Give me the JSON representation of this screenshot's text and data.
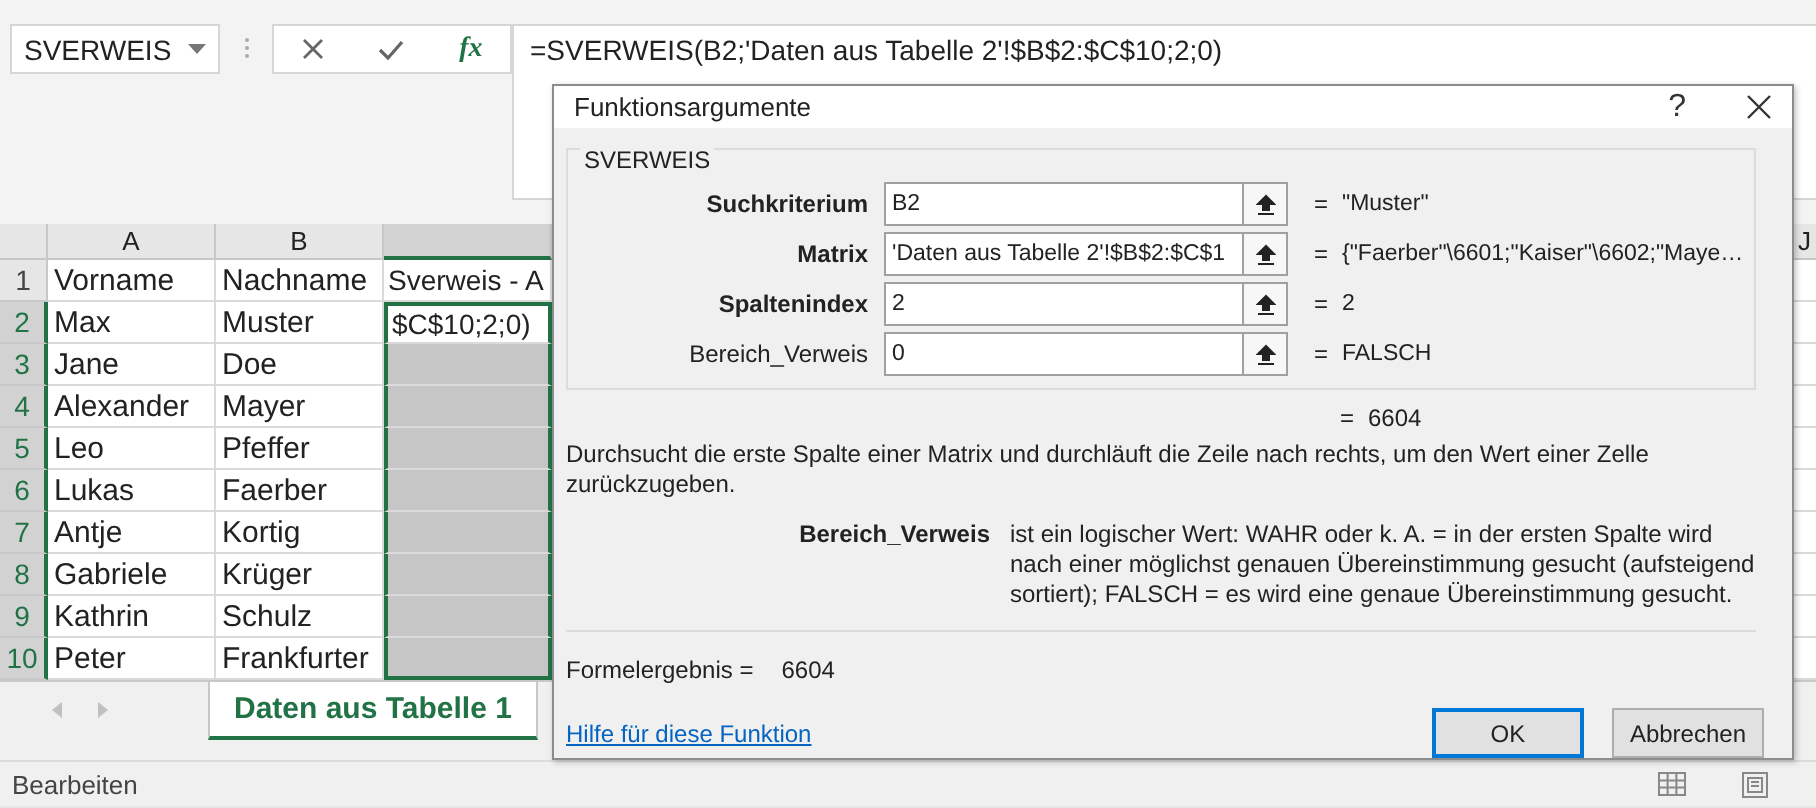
{
  "name_box": {
    "value": "SVERWEIS"
  },
  "formula_bar": {
    "fx": "fx",
    "formula": "=SVERWEIS(B2;'Daten aus Tabelle 2'!$B$2:$C$10;2;0)"
  },
  "columns": [
    {
      "label": "A",
      "selected": false
    },
    {
      "label": "B",
      "selected": false
    },
    {
      "selected": true
    }
  ],
  "right_column": {
    "label": "J"
  },
  "rows": [
    {
      "number": "1",
      "selected": false,
      "shaded": false,
      "cells": [
        "Vorname",
        "Nachname",
        "Sverweis - A"
      ]
    },
    {
      "number": "2",
      "selected": true,
      "shaded": false,
      "cells": [
        "Max",
        "Muster",
        "$C$10;2;0)"
      ]
    },
    {
      "number": "3",
      "selected": true,
      "shaded": true,
      "cells": [
        "Jane",
        "Doe"
      ]
    },
    {
      "number": "4",
      "selected": true,
      "shaded": true,
      "cells": [
        "Alexander",
        "Mayer"
      ]
    },
    {
      "number": "5",
      "selected": true,
      "shaded": true,
      "cells": [
        "Leo",
        "Pfeffer"
      ]
    },
    {
      "number": "6",
      "selected": true,
      "shaded": true,
      "cells": [
        "Lukas",
        "Faerber"
      ]
    },
    {
      "number": "7",
      "selected": true,
      "shaded": true,
      "cells": [
        "Antje",
        "Kortig"
      ]
    },
    {
      "number": "8",
      "selected": true,
      "shaded": true,
      "cells": [
        "Gabriele",
        "Krüger"
      ]
    },
    {
      "number": "9",
      "selected": true,
      "shaded": true,
      "cells": [
        "Kathrin",
        "Schulz"
      ]
    },
    {
      "number": "10",
      "selected": true,
      "shaded": true,
      "cells": [
        "Peter",
        "Frankfurter"
      ]
    }
  ],
  "sheet_tabs": [
    {
      "label": "Daten aus Tabelle 1",
      "selected": true
    }
  ],
  "status_bar": {
    "text": "Bearbeiten"
  },
  "dialog": {
    "title": "Funktionsargumente",
    "help": "?",
    "function": "SVERWEIS",
    "args": [
      {
        "label": "Suchkriterium",
        "bold": true,
        "value": "B2",
        "sign": "=",
        "result": "\"Muster\""
      },
      {
        "label": "Matrix",
        "bold": true,
        "value": "'Daten aus Tabelle 2'!$B$2:$C$1",
        "sign": "=",
        "result": "{\"Faerber\"\\6601;\"Kaiser\"\\6602;\"Maye…"
      },
      {
        "label": "Spaltenindex",
        "bold": true,
        "value": "2",
        "sign": "=",
        "result": "2"
      },
      {
        "label": "Bereich_Verweis",
        "bold": false,
        "value": "0",
        "sign": "=",
        "result": "FALSCH"
      }
    ],
    "total_sign": "=",
    "total": "6604",
    "description": "Durchsucht die erste Spalte einer Matrix und durchläuft die Zeile nach rechts, um den Wert einer Zelle zurückzugeben.",
    "param_name": "Bereich_Verweis",
    "param_text": "ist ein logischer Wert: WAHR oder k. A. = in der ersten Spalte wird nach einer möglichst genauen Übereinstimmung gesucht (aufsteigend sortiert); FALSCH = es wird eine genaue Übereinstimmung gesucht.",
    "result_label": "Formelergebnis =",
    "result": "6604",
    "link": "Hilfe für diese Funktion",
    "buttons": [
      {
        "label": "OK",
        "default": true
      },
      {
        "label": "Abbrechen",
        "default": false
      }
    ]
  }
}
